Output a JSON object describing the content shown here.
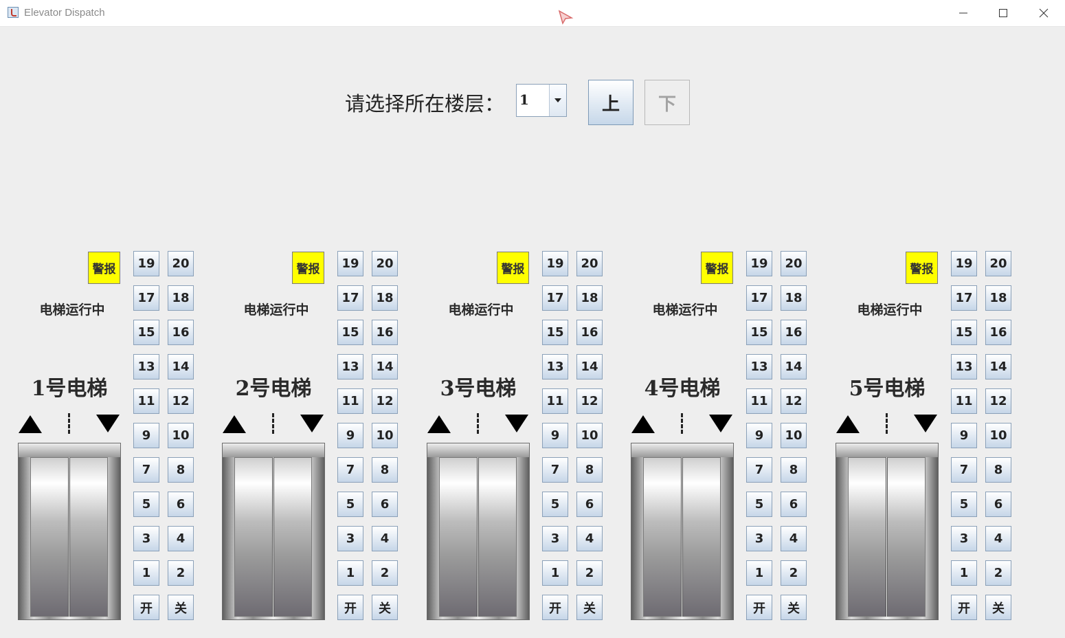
{
  "window": {
    "title": "Elevator Dispatch"
  },
  "control_panel": {
    "prompt": "请选择所在楼层：",
    "selected_floor": "1",
    "up_label": "上",
    "down_label": "下",
    "down_enabled": false
  },
  "elevators": [
    {
      "name": "1号电梯",
      "status": "电梯运行中",
      "alarm": "警报",
      "buttons": [
        [
          "19",
          "20"
        ],
        [
          "17",
          "18"
        ],
        [
          "15",
          "16"
        ],
        [
          "13",
          "14"
        ],
        [
          "11",
          "12"
        ],
        [
          "9",
          "10"
        ],
        [
          "7",
          "8"
        ],
        [
          "5",
          "6"
        ],
        [
          "3",
          "4"
        ],
        [
          "1",
          "2"
        ],
        [
          "开",
          "关"
        ]
      ]
    },
    {
      "name": "2号电梯",
      "status": "电梯运行中",
      "alarm": "警报",
      "buttons": [
        [
          "19",
          "20"
        ],
        [
          "17",
          "18"
        ],
        [
          "15",
          "16"
        ],
        [
          "13",
          "14"
        ],
        [
          "11",
          "12"
        ],
        [
          "9",
          "10"
        ],
        [
          "7",
          "8"
        ],
        [
          "5",
          "6"
        ],
        [
          "3",
          "4"
        ],
        [
          "1",
          "2"
        ],
        [
          "开",
          "关"
        ]
      ]
    },
    {
      "name": "3号电梯",
      "status": "电梯运行中",
      "alarm": "警报",
      "buttons": [
        [
          "19",
          "20"
        ],
        [
          "17",
          "18"
        ],
        [
          "15",
          "16"
        ],
        [
          "13",
          "14"
        ],
        [
          "11",
          "12"
        ],
        [
          "9",
          "10"
        ],
        [
          "7",
          "8"
        ],
        [
          "5",
          "6"
        ],
        [
          "3",
          "4"
        ],
        [
          "1",
          "2"
        ],
        [
          "开",
          "关"
        ]
      ]
    },
    {
      "name": "4号电梯",
      "status": "电梯运行中",
      "alarm": "警报",
      "buttons": [
        [
          "19",
          "20"
        ],
        [
          "17",
          "18"
        ],
        [
          "15",
          "16"
        ],
        [
          "13",
          "14"
        ],
        [
          "11",
          "12"
        ],
        [
          "9",
          "10"
        ],
        [
          "7",
          "8"
        ],
        [
          "5",
          "6"
        ],
        [
          "3",
          "4"
        ],
        [
          "1",
          "2"
        ],
        [
          "开",
          "关"
        ]
      ]
    },
    {
      "name": "5号电梯",
      "status": "电梯运行中",
      "alarm": "警报",
      "buttons": [
        [
          "19",
          "20"
        ],
        [
          "17",
          "18"
        ],
        [
          "15",
          "16"
        ],
        [
          "13",
          "14"
        ],
        [
          "11",
          "12"
        ],
        [
          "9",
          "10"
        ],
        [
          "7",
          "8"
        ],
        [
          "5",
          "6"
        ],
        [
          "3",
          "4"
        ],
        [
          "1",
          "2"
        ],
        [
          "开",
          "关"
        ]
      ]
    }
  ],
  "colors": {
    "background": "#eeeeee",
    "alarm": "#ffff00",
    "button_border": "#8aa0b8"
  },
  "icons": {
    "app": "java-cup-icon",
    "up": "up-arrow-icon",
    "down": "down-arrow-icon",
    "open_door": "door-open-label",
    "close_door": "door-close-label"
  }
}
